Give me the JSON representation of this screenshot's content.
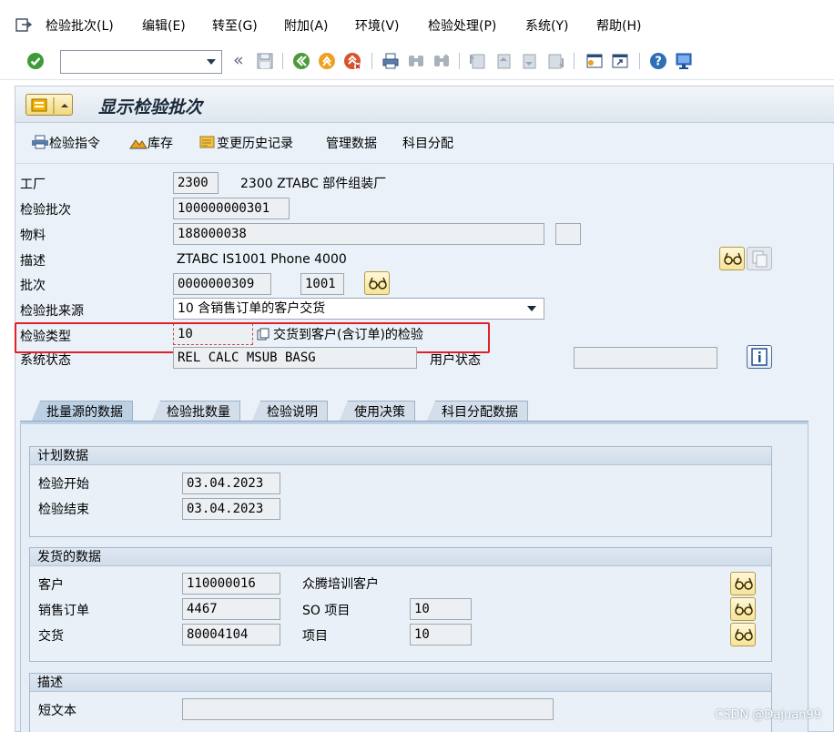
{
  "menu": {
    "items": [
      "检验批次(L)",
      "编辑(E)",
      "转至(G)",
      "附加(A)",
      "环境(V)",
      "检验处理(P)",
      "系统(Y)",
      "帮助(H)"
    ]
  },
  "toolbar": {
    "command_field_value": "",
    "back_glyph": "«"
  },
  "screen": {
    "title": "显示检验批次"
  },
  "app_toolbar": {
    "inspection_instruction": "检验指令",
    "stock": "库存",
    "change_history": "变更历史记录",
    "admin_data": "管理数据",
    "account_assignment": "科目分配"
  },
  "header_fields": {
    "plant_label": "工厂",
    "plant_value": "2300",
    "plant_text": "2300 ZTABC 部件组装厂",
    "lot_label": "检验批次",
    "lot_value": "100000000301",
    "material_label": "物料",
    "material_value": "188000038",
    "material_extra": "",
    "description_label": "描述",
    "description_value": "ZTABC IS1001 Phone 4000",
    "batch_label": "批次",
    "batch_value": "0000000309",
    "batch_plant": "1001",
    "origin_label": "检验批来源",
    "origin_value": "10 含销售订单的客户交货",
    "type_label": "检验类型",
    "type_value": "10",
    "type_text": "交货到客户(含订单)的检验",
    "system_status_label": "系统状态",
    "system_status_value": "REL  CALC  MSUB  BASG",
    "user_status_label": "用户状态",
    "user_status_value": ""
  },
  "tabs": [
    {
      "label": "批量源的数据",
      "active": true
    },
    {
      "label": "检验批数量",
      "active": false
    },
    {
      "label": "检验说明",
      "active": false
    },
    {
      "label": "使用决策",
      "active": false
    },
    {
      "label": "科目分配数据",
      "active": false
    }
  ],
  "plan_group": {
    "title": "计划数据",
    "start_label": "检验开始",
    "start_value": "03.04.2023",
    "end_label": "检验结束",
    "end_value": "03.04.2023"
  },
  "delivery_group": {
    "title": "发货的数据",
    "customer_label": "客户",
    "customer_value": "110000016",
    "customer_name": "众腾培训客户",
    "sales_order_label": "销售订单",
    "sales_order_value": "4467",
    "so_item_label": "SO 项目",
    "so_item_value": "10",
    "delivery_label": "交货",
    "delivery_value": "80004104",
    "item_label": "项目",
    "item_value": "10"
  },
  "desc_group": {
    "title": "描述",
    "short_text_label": "短文本",
    "short_text_value": ""
  },
  "watermark": "CSDN @Dajuan99",
  "colors": {
    "highlight": "#e0202a",
    "panel_bg": "#eaf1f8",
    "field_border": "#9ea8b4"
  }
}
